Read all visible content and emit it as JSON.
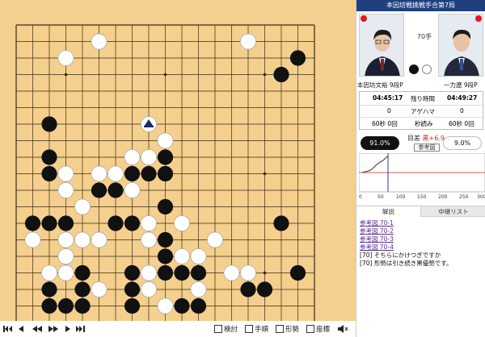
{
  "board": {
    "size": 19,
    "hoshi": [
      [
        3,
        3
      ],
      [
        3,
        9
      ],
      [
        3,
        15
      ],
      [
        9,
        3
      ],
      [
        9,
        9
      ],
      [
        9,
        15
      ],
      [
        15,
        3
      ],
      [
        15,
        9
      ],
      [
        15,
        15
      ]
    ],
    "black_stones": [
      [
        2,
        17
      ],
      [
        3,
        16
      ],
      [
        6,
        2
      ],
      [
        8,
        2
      ],
      [
        8,
        9
      ],
      [
        9,
        2
      ],
      [
        9,
        7
      ],
      [
        9,
        8
      ],
      [
        9,
        9
      ],
      [
        10,
        5
      ],
      [
        10,
        6
      ],
      [
        11,
        9
      ],
      [
        12,
        1
      ],
      [
        12,
        2
      ],
      [
        12,
        3
      ],
      [
        12,
        6
      ],
      [
        12,
        7
      ],
      [
        12,
        16
      ],
      [
        13,
        9
      ],
      [
        14,
        9
      ],
      [
        15,
        4
      ],
      [
        15,
        7
      ],
      [
        15,
        9
      ],
      [
        15,
        10
      ],
      [
        15,
        11
      ],
      [
        15,
        17
      ],
      [
        16,
        2
      ],
      [
        16,
        4
      ],
      [
        16,
        7
      ],
      [
        16,
        14
      ],
      [
        16,
        15
      ],
      [
        17,
        2
      ],
      [
        17,
        3
      ],
      [
        17,
        4
      ],
      [
        17,
        7
      ],
      [
        17,
        10
      ],
      [
        17,
        11
      ]
    ],
    "white_stones": [
      [
        1,
        5
      ],
      [
        1,
        14
      ],
      [
        2,
        3
      ],
      [
        7,
        9
      ],
      [
        8,
        7
      ],
      [
        8,
        8
      ],
      [
        9,
        3
      ],
      [
        9,
        5
      ],
      [
        9,
        6
      ],
      [
        10,
        3
      ],
      [
        10,
        7
      ],
      [
        11,
        4
      ],
      [
        12,
        8
      ],
      [
        12,
        10
      ],
      [
        13,
        1
      ],
      [
        13,
        3
      ],
      [
        13,
        4
      ],
      [
        13,
        5
      ],
      [
        13,
        8
      ],
      [
        13,
        12
      ],
      [
        14,
        3
      ],
      [
        14,
        10
      ],
      [
        14,
        11
      ],
      [
        15,
        2
      ],
      [
        15,
        3
      ],
      [
        15,
        8
      ],
      [
        15,
        13
      ],
      [
        15,
        14
      ],
      [
        16,
        5
      ],
      [
        16,
        8
      ],
      [
        16,
        11
      ],
      [
        17,
        9
      ]
    ],
    "last_move_marker": [
      6,
      8
    ],
    "colors": {
      "board": "#f4cf8d",
      "line": "#3a2a14",
      "black": "#111111",
      "white": "#ffffff"
    }
  },
  "controls": {
    "review_label": "検討",
    "moves_label": "手順",
    "shape_label": "形勢",
    "coords_label": "座標"
  },
  "panel": {
    "title": "本因坊戦挑戦手合第7局",
    "move_label": "70手",
    "black_player": "本因坊文裕 9段P",
    "white_player": "一力遼 9段P",
    "black_time": "04:45:17",
    "time_label": "残り時間",
    "white_time": "04:49:27",
    "black_captures": "0",
    "captures_label": "アゲハマ",
    "white_captures": "0",
    "black_byoyomi": "60秒 0回",
    "byoyomi_label": "秒読み",
    "white_byoyomi": "60秒 0回",
    "black_winrate": "91.0%",
    "white_winrate": "9.0%",
    "diff_prefix": "目差",
    "diff_value": "黒+6.9",
    "ref_button": "参考図",
    "graph_ticks": [
      "0",
      "50",
      "100",
      "150",
      "200",
      "250",
      "300"
    ],
    "tabs": {
      "commentary": "解説",
      "list": "中継リスト"
    },
    "ref_links": [
      "参考図 70-1",
      "参考図 70-2",
      "参考図 70-3",
      "参考図 70-4"
    ],
    "comments": [
      "[70] そちらにかけつぎですか",
      "[70] 形勢は引き続き黒優勢です。"
    ],
    "accent": "#1f3f7f",
    "red": "#e0191f"
  }
}
